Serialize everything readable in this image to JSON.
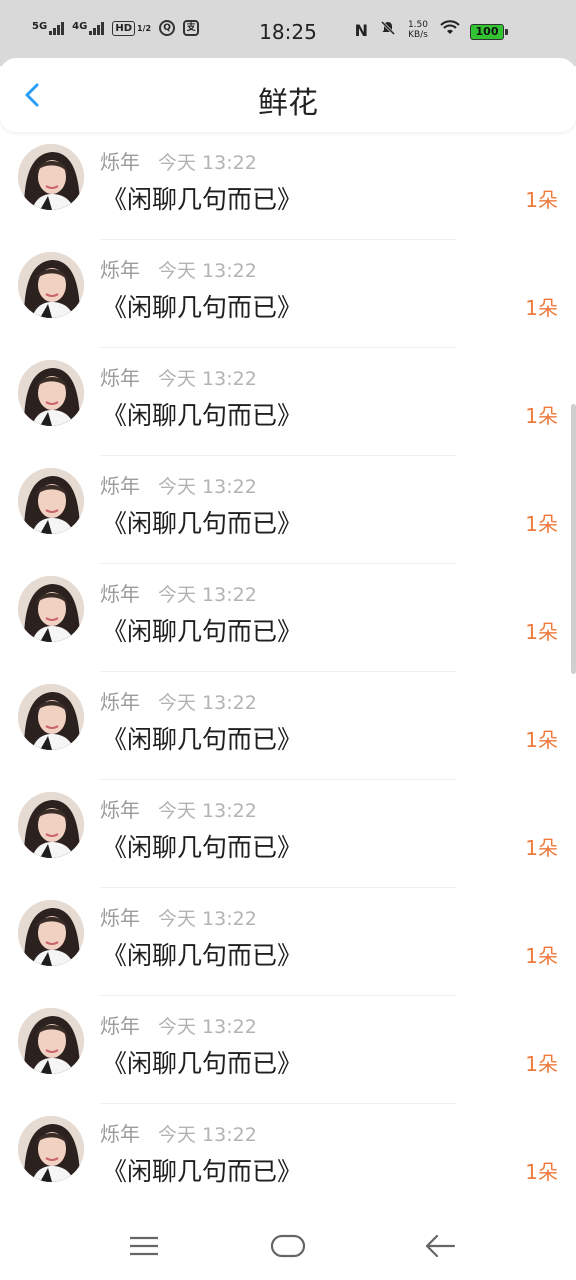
{
  "status_bar": {
    "sig1": "5G",
    "sig2": "4G",
    "hd": "HD",
    "hd_sub": "1/2",
    "app1": "Q",
    "app2": "支",
    "time": "18:25",
    "speed_value": "1.50",
    "speed_unit": "KB/s",
    "battery": "100"
  },
  "header": {
    "title": "鲜花"
  },
  "colors": {
    "accent": "#2a9ef5",
    "count": "#ee7b3c"
  },
  "rows": [
    {
      "name": "烁年",
      "time": "今天 13:22",
      "message": "《闲聊几句而已》",
      "count": "1朵"
    },
    {
      "name": "烁年",
      "time": "今天 13:22",
      "message": "《闲聊几句而已》",
      "count": "1朵"
    },
    {
      "name": "烁年",
      "time": "今天 13:22",
      "message": "《闲聊几句而已》",
      "count": "1朵"
    },
    {
      "name": "烁年",
      "time": "今天 13:22",
      "message": "《闲聊几句而已》",
      "count": "1朵"
    },
    {
      "name": "烁年",
      "time": "今天 13:22",
      "message": "《闲聊几句而已》",
      "count": "1朵"
    },
    {
      "name": "烁年",
      "time": "今天 13:22",
      "message": "《闲聊几句而已》",
      "count": "1朵"
    },
    {
      "name": "烁年",
      "time": "今天 13:22",
      "message": "《闲聊几句而已》",
      "count": "1朵"
    },
    {
      "name": "烁年",
      "time": "今天 13:22",
      "message": "《闲聊几句而已》",
      "count": "1朵"
    },
    {
      "name": "烁年",
      "time": "今天 13:22",
      "message": "《闲聊几句而已》",
      "count": "1朵"
    },
    {
      "name": "烁年",
      "time": "今天 13:22",
      "message": "《闲聊几句而已》",
      "count": "1朵"
    }
  ],
  "nav": {
    "menu_icon": "menu-icon",
    "home_icon": "home-icon",
    "back_icon": "back-arrow-icon"
  }
}
